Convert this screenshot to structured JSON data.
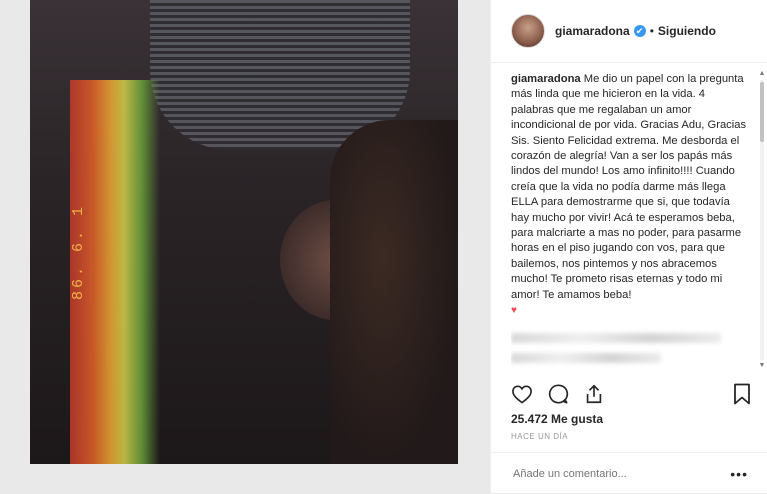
{
  "photo": {
    "date_stamp": "86. 6. 1"
  },
  "header": {
    "username": "giamaradona",
    "verified_icon": "✔",
    "separator": "•",
    "follow_status": "Siguiendo"
  },
  "caption": {
    "username": "giamaradona",
    "text": "Me dio un papel con la pregunta más linda que me hicieron en la vida. 4 palabras que me regalaban un amor incondicional de por vida. Gracias Adu, Gracias Sis. Siento Felicidad extrema. Me desborda el corazón de alegría! Van a ser los papás más lindos del mundo! Los amo infinito!!!! Cuando creía que la vida no podía darme más llega ELLA para demostrarme que si, que todavía hay mucho por vivir! Acá te esperamos beba, para malcriarte a mas no poder, para pasarme horas en el piso jugando con vos, para que bailemos, nos pintemos y nos abracemos mucho! Te prometo risas eternas y todo mi amor! Te amamos beba!",
    "emoji": "♥"
  },
  "actions": {
    "like_icon": "heart-icon",
    "comment_icon": "comment-icon",
    "share_icon": "share-icon",
    "save_icon": "bookmark-icon"
  },
  "likes": "25.472 Me gusta",
  "timestamp": "HACE UN DÍA",
  "comment_box": {
    "placeholder": "Añade un comentario...",
    "more_label": "•••"
  },
  "colors": {
    "verified": "#3897f0",
    "heart": "#ed4956",
    "date_stamp": "#f2b24a"
  }
}
